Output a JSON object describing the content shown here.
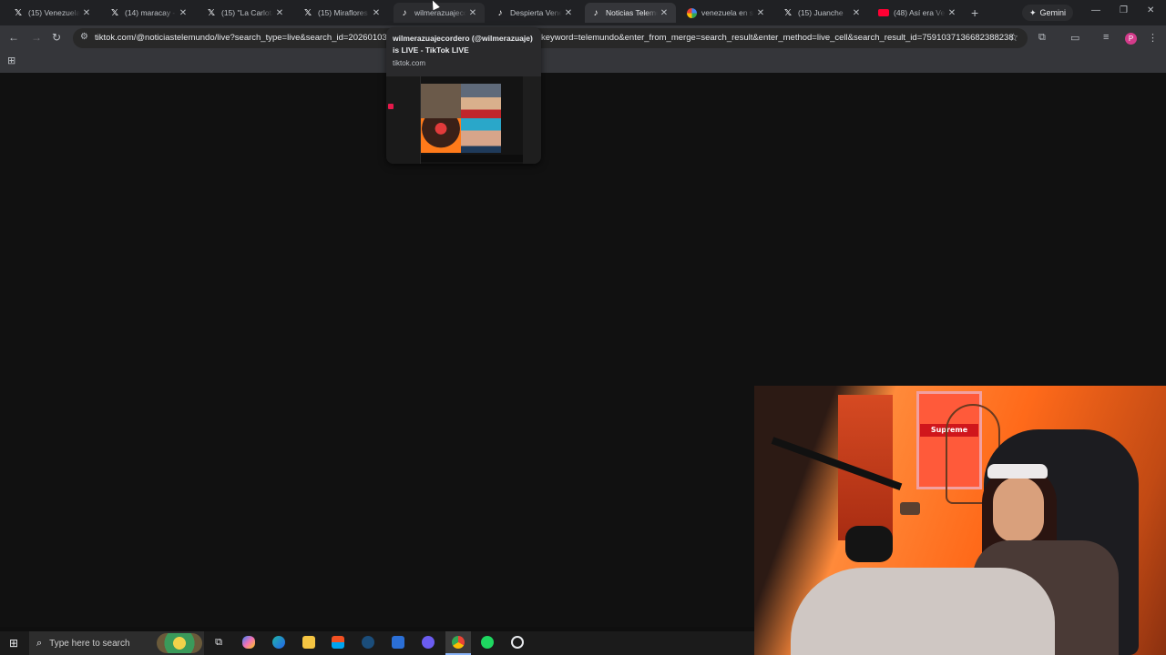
{
  "browser": {
    "tabs": [
      {
        "title": "(15) Venezuela",
        "favicon": "x-icon",
        "active": false
      },
      {
        "title": "(14) maracay - S",
        "favicon": "x-icon",
        "active": false
      },
      {
        "title": "(15) \"La Carlota\"",
        "favicon": "x-icon",
        "active": false
      },
      {
        "title": "(15) Miraflores",
        "favicon": "x-icon",
        "active": false
      },
      {
        "title": "wilmerazuajeco",
        "favicon": "tiktok-icon",
        "active": false
      },
      {
        "title": "Despierta Vene",
        "favicon": "tiktok-icon",
        "active": false
      },
      {
        "title": "Noticias Telemu",
        "favicon": "tiktok-icon",
        "active": true
      },
      {
        "title": "venezuela en su",
        "favicon": "google-icon",
        "active": false
      },
      {
        "title": "(15) Juanche",
        "favicon": "x-icon",
        "active": false
      },
      {
        "title": "(48) Así era Ven",
        "favicon": "youtube-icon",
        "active": false
      }
    ],
    "gemini_label": "Gemini",
    "address_bar": {
      "url_start": "tiktok.com/@noticiastelemundo/live?search_type=live&search_id=202601030",
      "url_end": "keyword=telemundo&enter_from_merge=search_result&enter_method=live_cell&search_result_id=7591037136682388238"
    },
    "profile_initial": "P"
  },
  "hover_card": {
    "title": "wilmerazuajecordero (@wilmerazuaje) is LIVE - TikTok LIVE",
    "domain": "tiktok.com"
  },
  "webcam": {
    "sign_text": "Supreme"
  },
  "taskbar": {
    "search_placeholder": "Type here to search",
    "pinned": [
      "task-view-icon",
      "copilot-icon",
      "edge-icon",
      "file-explorer-icon",
      "store-icon",
      "steam-icon",
      "mail-icon",
      "discord-icon",
      "chrome-icon",
      "spotify-icon",
      "speedtest-icon"
    ]
  },
  "colors": {
    "tabbar": "#202124",
    "toolbar": "#35363a",
    "content_bg": "#111111",
    "taskbar": "#1b1b1b",
    "active_indicator": "#8ab4f8"
  }
}
